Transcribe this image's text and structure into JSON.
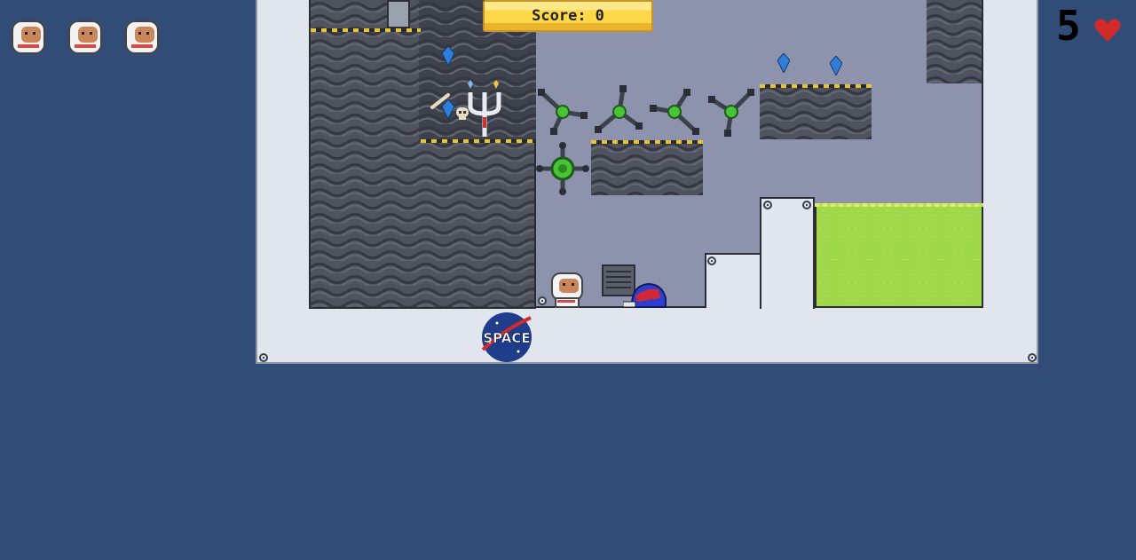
{
  "hud": {
    "score_label": "Score:",
    "score_value": "0",
    "hearts": "5",
    "lives_count": 3
  },
  "logo": {
    "text": "SPACE"
  },
  "colors": {
    "background": "#324c78",
    "frame": "#e1e6ee",
    "rock": "#4e535e",
    "acid": "#cde95a",
    "score_box": "#ffd84a",
    "heart": "#d42a2a",
    "gem": "#2f7fd8"
  },
  "icons": [
    "astronaut-life-icon",
    "heart-icon",
    "blue-gem-icon",
    "rotating-blade-trap-icon",
    "skull-icon",
    "bone-icon",
    "candelabra-icon",
    "vent-grate-icon",
    "crawler-enemy-icon",
    "player-astronaut-icon"
  ]
}
